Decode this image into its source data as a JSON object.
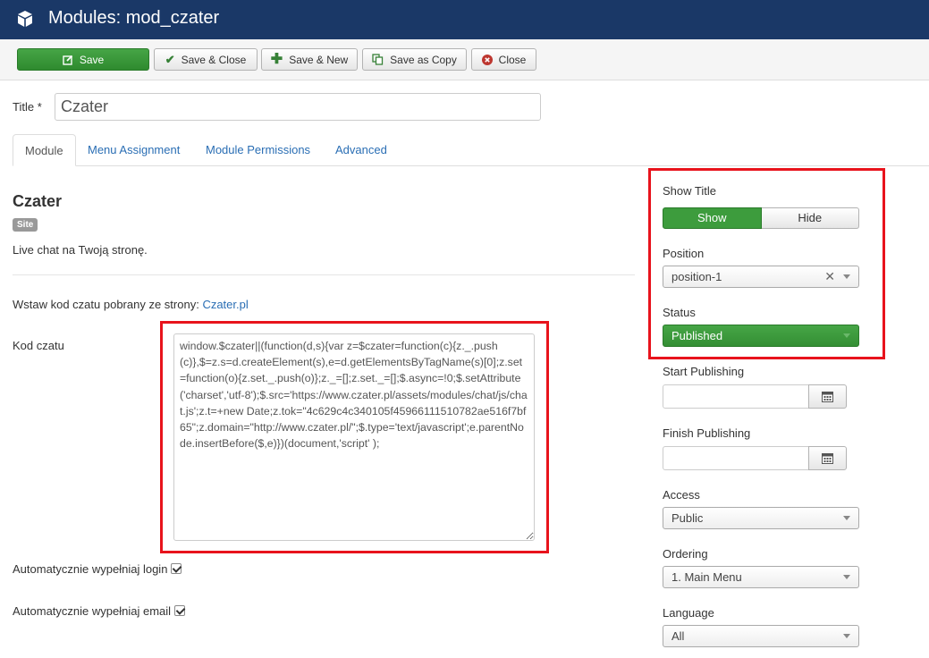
{
  "header": {
    "title": "Modules: mod_czater",
    "icon": "cube-icon"
  },
  "toolbar": {
    "save": "Save",
    "save_close": "Save & Close",
    "save_new": "Save & New",
    "save_copy": "Save as Copy",
    "close": "Close"
  },
  "title_field": {
    "label": "Title *",
    "value": "Czater"
  },
  "tabs": [
    "Module",
    "Menu Assignment",
    "Module Permissions",
    "Advanced"
  ],
  "module": {
    "name": "Czater",
    "badge": "Site",
    "description": "Live chat na Twoją stronę."
  },
  "info": {
    "text": "Wstaw kod czatu pobrany ze strony: ",
    "link": "Czater.pl"
  },
  "code": {
    "label": "Kod czatu",
    "value": "window.$czater||(function(d,s){var z=$czater=function(c){z._.push(c)},$=z.s=d.createElement(s),e=d.getElementsByTagName(s)[0];z.set=function(o){z.set._.push(o)};z._=[];z.set._=[];$.async=!0;$.setAttribute('charset','utf-8');$.src='https://www.czater.pl/assets/modules/chat/js/chat.js';z.t=+new Date;z.tok=\"4c629c4c340105f45966111510782ae516f7bf65\";z.domain=\"http://www.czater.pl/\";$.type='text/javascript';e.parentNode.insertBefore($,e)})(document,'script' );"
  },
  "checkboxes": {
    "login": {
      "label": "Automatycznie wypełniaj login",
      "checked": true
    },
    "email": {
      "label": "Automatycznie wypełniaj email",
      "checked": true
    }
  },
  "sidebar": {
    "show_title": {
      "label": "Show Title",
      "on": "Show",
      "off": "Hide",
      "selected": "Show"
    },
    "position": {
      "label": "Position",
      "value": "position-1"
    },
    "status": {
      "label": "Status",
      "value": "Published"
    },
    "start_publishing": {
      "label": "Start Publishing",
      "value": ""
    },
    "finish_publishing": {
      "label": "Finish Publishing",
      "value": ""
    },
    "access": {
      "label": "Access",
      "value": "Public"
    },
    "ordering": {
      "label": "Ordering",
      "value": "1. Main Menu"
    },
    "language": {
      "label": "Language",
      "value": "All"
    }
  },
  "colors": {
    "header": "#1a3867",
    "success": "#46a546",
    "link": "#2a6eb4",
    "highlight": "#e8131c"
  }
}
